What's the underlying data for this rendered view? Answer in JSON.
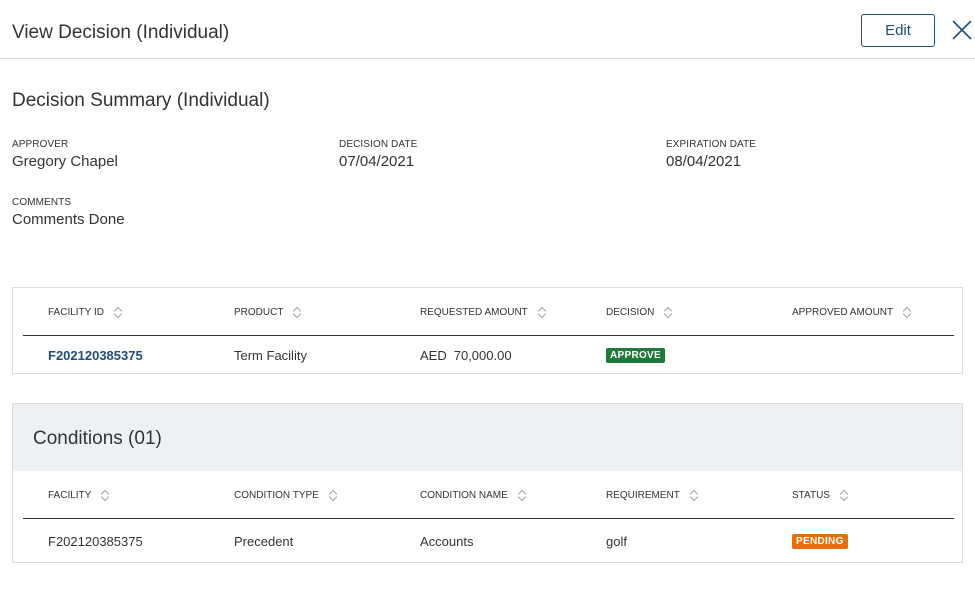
{
  "header": {
    "title": "View Decision (Individual)",
    "edit_label": "Edit",
    "close_icon": "close-icon"
  },
  "summary": {
    "title": "Decision Summary (Individual)",
    "approver_label": "APPROVER",
    "approver": "Gregory Chapel",
    "decision_date_label": "DECISION DATE",
    "decision_date": "07/04/2021",
    "expiration_date_label": "EXPIRATION DATE",
    "expiration_date": "08/04/2021",
    "comments_label": "COMMENTS",
    "comments": "Comments Done"
  },
  "decision_table": {
    "columns": [
      "FACILITY ID",
      "PRODUCT",
      "REQUESTED AMOUNT",
      "DECISION",
      "APPROVED AMOUNT"
    ],
    "rows": [
      {
        "facility_id": "F202120385375",
        "product": "Term Facility",
        "currency": "AED",
        "amount": "70,000.00",
        "decision": "APPROVE",
        "approved_amount": ""
      }
    ]
  },
  "conditions": {
    "title": "Conditions (01)",
    "columns": [
      "FACILITY",
      "CONDITION TYPE",
      "CONDITION NAME",
      "REQUIREMENT",
      "STATUS"
    ],
    "rows": [
      {
        "facility": "F202120385375",
        "condition_type": "Precedent",
        "condition_name": "Accounts",
        "requirement": "golf",
        "status": "PENDING"
      }
    ]
  },
  "colors": {
    "accent": "#1f4e79",
    "approve": "#217a3c",
    "pending": "#e46d0d",
    "panel_header": "#eef1f3"
  }
}
